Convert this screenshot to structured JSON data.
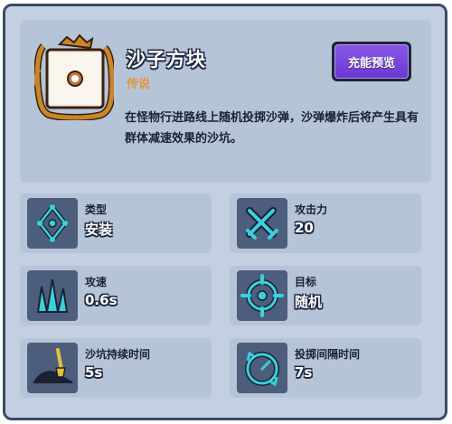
{
  "tower": {
    "name": "沙子方块",
    "rarity": "传说",
    "description": "在怪物行进路线上随机投掷沙弹，沙弹爆炸后将产生具有群体减速效果的沙坑。",
    "portrait_icon": "sand-block-portrait-icon",
    "rarity_color": "#e2983a"
  },
  "buttons": {
    "preview": "充能预览"
  },
  "stats": [
    {
      "label": "类型",
      "value": "安装",
      "icon": "diamond-node-icon"
    },
    {
      "label": "攻击力",
      "value": "20",
      "icon": "crossed-swords-icon"
    },
    {
      "label": "攻速",
      "value": "0.6s",
      "icon": "crystal-shards-icon"
    },
    {
      "label": "目标",
      "value": "随机",
      "icon": "crosshair-target-icon"
    },
    {
      "label": "沙坑持续时间",
      "value": "5s",
      "icon": "sand-pile-shovel-icon"
    },
    {
      "label": "投掷间隔时间",
      "value": "7s",
      "icon": "timer-cycle-icon"
    }
  ],
  "colors": {
    "accent": "#7a4ae0",
    "icon_cyan": "#3ad0dc",
    "panel": "#c4d0e2"
  }
}
